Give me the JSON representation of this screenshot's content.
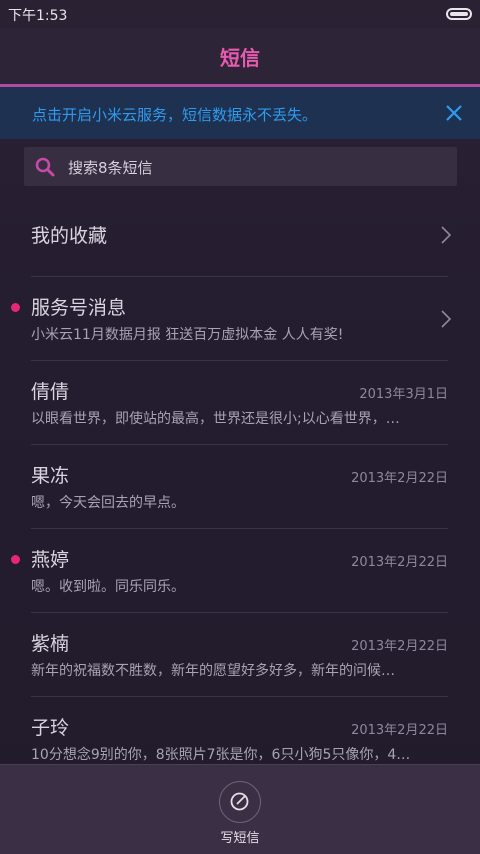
{
  "status_bar": {
    "time": "下午1:53"
  },
  "header": {
    "title": "短信"
  },
  "notice": {
    "text": "点击开启小米云服务，短信数据永不丢失。"
  },
  "search": {
    "placeholder": "搜索8条短信"
  },
  "favorites": {
    "label": "我的收藏"
  },
  "conversations": [
    {
      "name": "服务号消息",
      "date": "",
      "preview": "小米云11月数据月报 狂送百万虚拟本金 人人有奖!",
      "unread": true,
      "chevron": true
    },
    {
      "name": "倩倩",
      "date": "2013年3月1日",
      "preview": "以眼看世界，即使站的最高，世界还是很小;以心看世界，…",
      "unread": false,
      "chevron": false
    },
    {
      "name": "果冻",
      "date": "2013年2月22日",
      "preview": "嗯，今天会回去的早点。",
      "unread": false,
      "chevron": false
    },
    {
      "name": "燕婷",
      "date": "2013年2月22日",
      "preview": "嗯。收到啦。同乐同乐。",
      "unread": true,
      "chevron": false
    },
    {
      "name": "紫楠",
      "date": "2013年2月22日",
      "preview": "新年的祝福数不胜数，新年的愿望好多好多，新年的问候…",
      "unread": false,
      "chevron": false
    },
    {
      "name": "子玲",
      "date": "2013年2月22日",
      "preview": "10分想念9别的你，8张照片7张是你，6只小狗5只像你，4…",
      "unread": false,
      "chevron": false
    }
  ],
  "bottom": {
    "compose_label": "写短信"
  },
  "colors": {
    "accent": "#e65ab0",
    "notice_text": "#2f9bef",
    "unread_dot": "#e6267a"
  }
}
